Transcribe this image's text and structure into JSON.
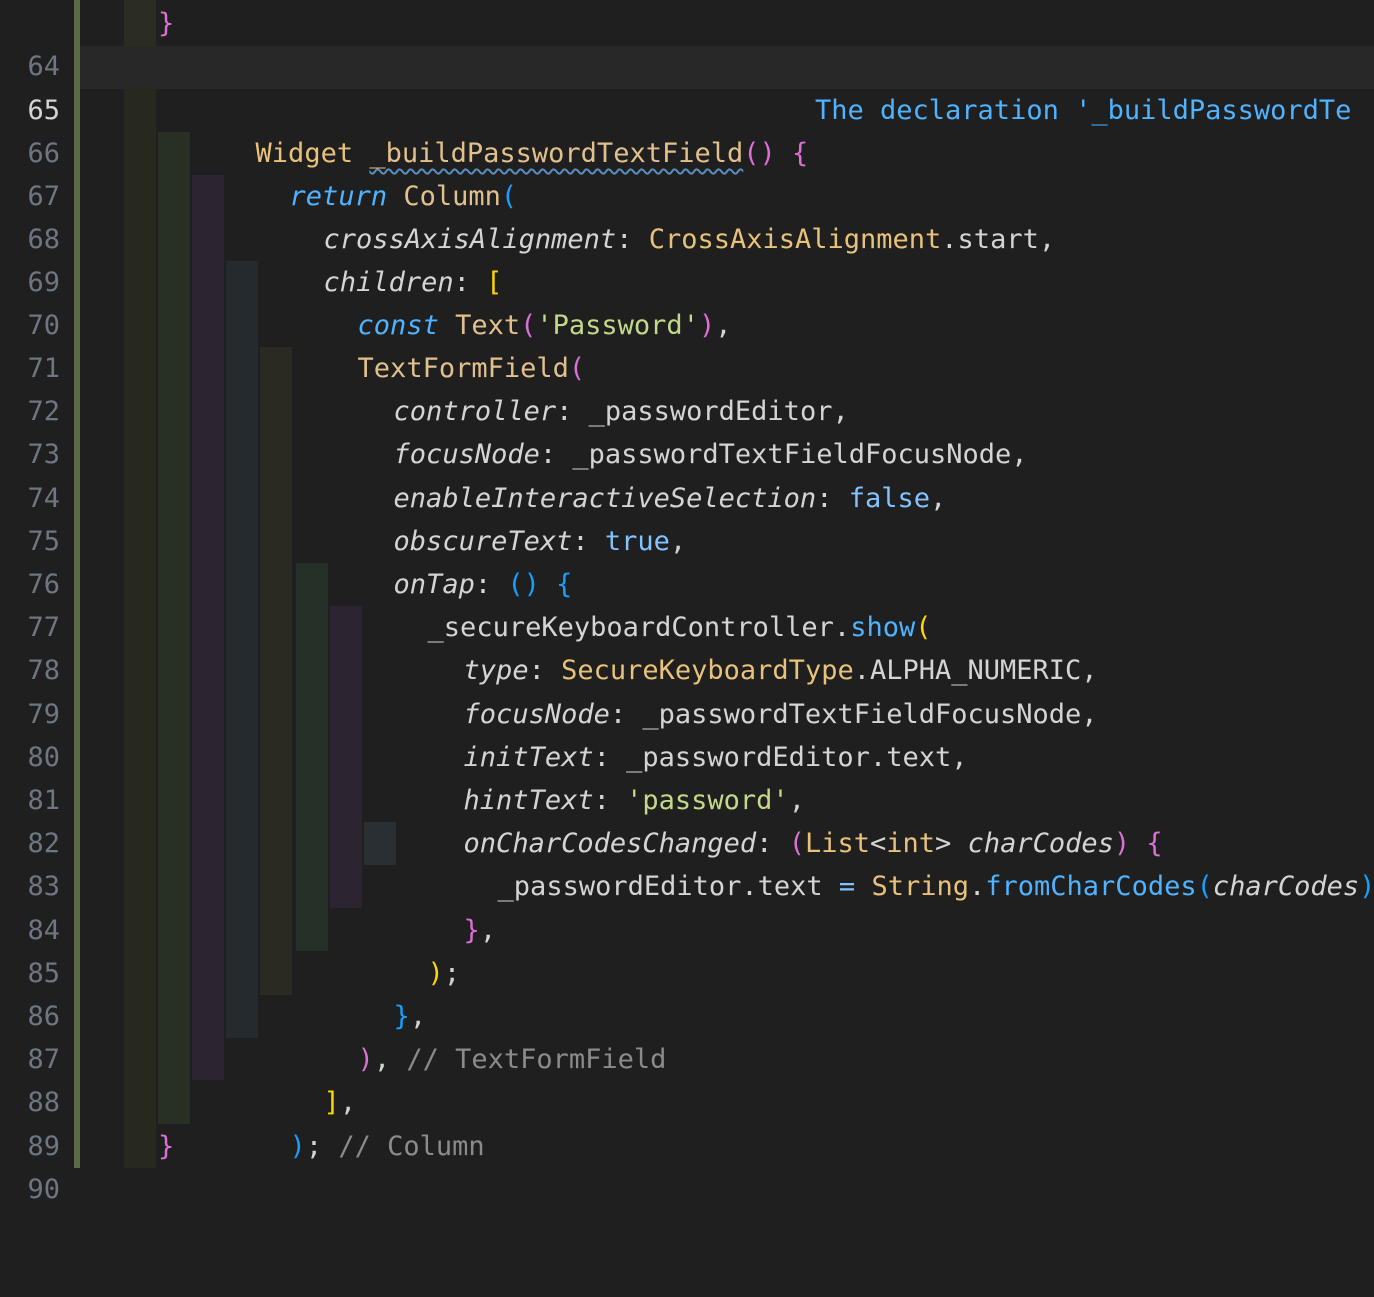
{
  "editor": {
    "line_numbers": [
      "64",
      "65",
      "66",
      "67",
      "68",
      "69",
      "70",
      "71",
      "72",
      "73",
      "74",
      "75",
      "76",
      "77",
      "78",
      "79",
      "80",
      "81",
      "82",
      "83",
      "84",
      "85",
      "86",
      "87",
      "88",
      "89",
      "90"
    ],
    "active_line": "65",
    "hint_text": "The declaration '_buildPasswordTe",
    "lines": {
      "l64": "}",
      "l66a": "Widget",
      "l66b": "_buildPasswordTextField",
      "l66c": "()",
      "l66d": "{",
      "l67a": "return",
      "l67b": "Column",
      "l67c": "(",
      "l68a": "crossAxisAlignment",
      "l68b": ":",
      "l68c": "CrossAxisAlignment",
      "l68d": ".start,",
      "l69a": "children",
      "l69b": ":",
      "l69c": "[",
      "l70a": "const",
      "l70b": "Text",
      "l70c": "(",
      "l70d": "'Password'",
      "l70e": ")",
      "l70f": ",",
      "l71a": "TextFormField",
      "l71b": "(",
      "l72a": "controller",
      "l72b": ": _passwordEditor,",
      "l73a": "focusNode",
      "l73b": ": _passwordTextFieldFocusNode,",
      "l74a": "enableInteractiveSelection",
      "l74b": ":",
      "l74c": "false",
      "l74d": ",",
      "l75a": "obscureText",
      "l75b": ":",
      "l75c": "true",
      "l75d": ",",
      "l76a": "onTap",
      "l76b": ":",
      "l76c": "()",
      "l76d": "{",
      "l77a": "_secureKeyboardController.",
      "l77b": "show",
      "l77c": "(",
      "l78a": "type",
      "l78b": ":",
      "l78c": "SecureKeyboardType",
      "l78d": ".ALPHA_NUMERIC,",
      "l79a": "focusNode",
      "l79b": ": _passwordTextFieldFocusNode,",
      "l80a": "initText",
      "l80b": ": _passwordEditor.text,",
      "l81a": "hintText",
      "l81b": ":",
      "l81c": "'password'",
      "l81d": ",",
      "l82a": "onCharCodesChanged",
      "l82b": ":",
      "l82c": "(",
      "l82d": "List",
      "l82e": "<",
      "l82f": "int",
      "l82g": ">",
      "l82h": "charCodes",
      "l82i": ")",
      "l82j": "{",
      "l83a": "_passwordEditor.text",
      "l83b": "=",
      "l83c": "String",
      "l83d": ".",
      "l83e": "fromCharCodes",
      "l83f": "(",
      "l83g": "charCodes",
      "l83h": ")",
      "l83i": ";",
      "l84a": "}",
      "l84b": ",",
      "l85a": ")",
      "l85b": ";",
      "l86a": "}",
      "l86b": ",",
      "l87a": ")",
      "l87b": ",",
      "l87c": "// TextFormField",
      "l88a": "]",
      "l88b": ",",
      "l89a": ")",
      "l89b": ";",
      "l89c": "// Column",
      "l90": "}"
    }
  },
  "colors": {
    "background": "#1f1f1f",
    "gutter_bar": "#5b6b46",
    "current_line": "#282828"
  }
}
